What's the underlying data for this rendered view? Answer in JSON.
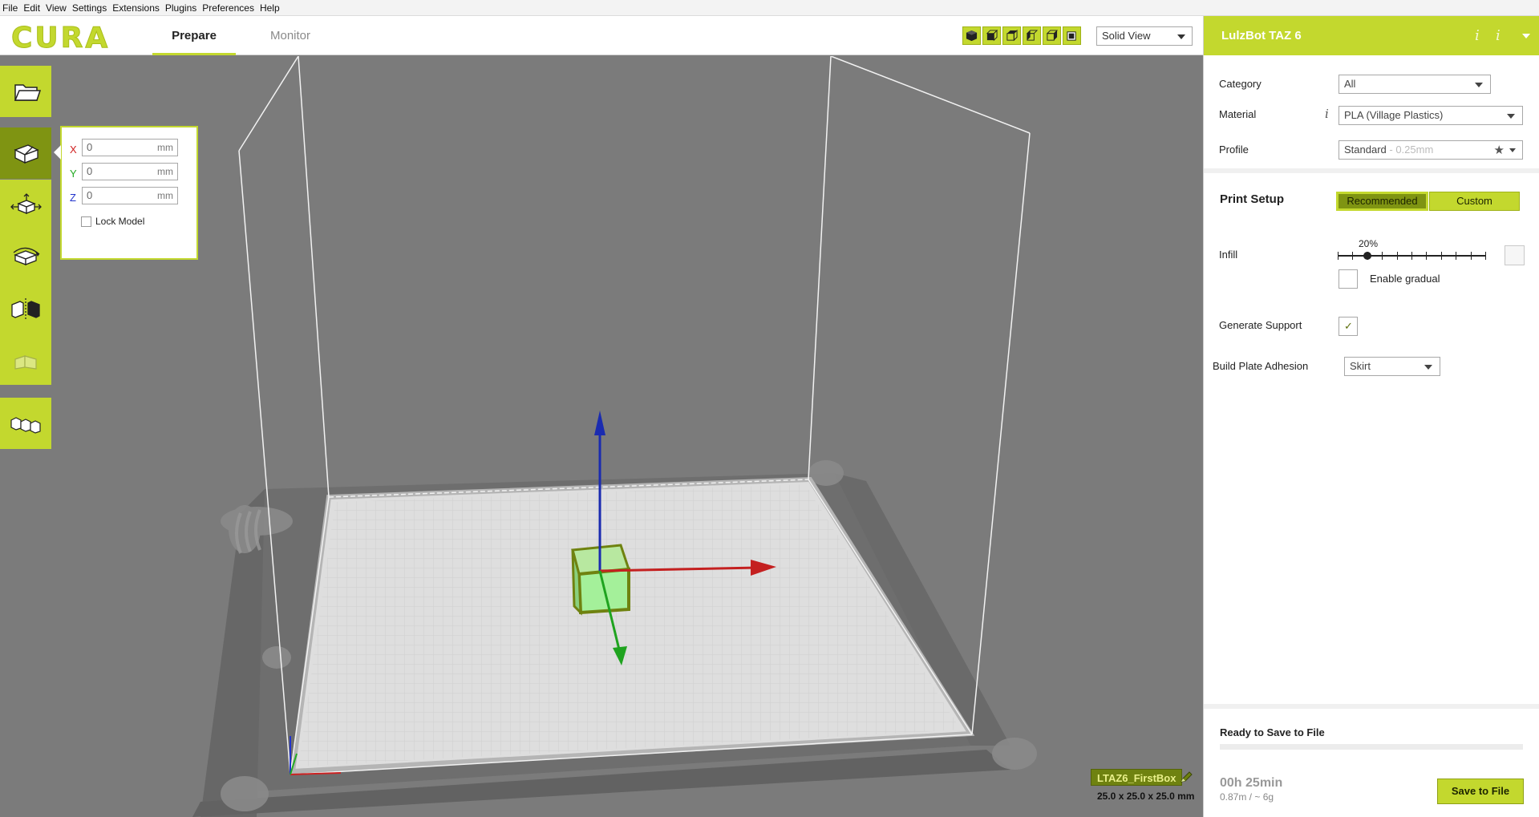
{
  "menu": [
    "File",
    "Edit",
    "View",
    "Settings",
    "Extensions",
    "Plugins",
    "Preferences",
    "Help"
  ],
  "header": {
    "logo": "CURA",
    "tabs": [
      "Prepare",
      "Monitor"
    ],
    "view_mode": "Solid View",
    "view_buttons": [
      "3d-view-icon",
      "front-view-icon",
      "top-view-icon",
      "left-view-icon",
      "right-view-icon",
      "x-ray-icon"
    ]
  },
  "panel": {
    "printer": "LulzBot TAZ 6",
    "category_label": "Category",
    "category_value": "All",
    "material_label": "Material",
    "material_value": "PLA (Village Plastics)",
    "profile_label": "Profile",
    "profile_value": "Standard",
    "profile_suffix": " - 0.25mm",
    "print_setup": "Print Setup",
    "recommended": "Recommended",
    "custom": "Custom",
    "infill_label": "Infill",
    "infill_value": "20%",
    "infill_fraction": 0.2,
    "enable_gradual": "Enable gradual",
    "generate_support": "Generate Support",
    "generate_support_checked": true,
    "adhesion_label": "Build Plate Adhesion",
    "adhesion_value": "Skirt",
    "status": "Ready to Save to File",
    "time": "00h 25min",
    "usage": "0.87m / ~ 6g",
    "save_button": "Save to File"
  },
  "tools": [
    "open-file-icon",
    "translate-icon",
    "move-icon",
    "rotate-icon",
    "mirror-icon",
    "per-model-settings-icon",
    "multiply-icon"
  ],
  "position": {
    "x_label": "X",
    "x_value": "0",
    "y_label": "Y",
    "y_value": "0",
    "z_label": "Z",
    "z_value": "0",
    "unit": "mm",
    "lock_model": "Lock Model"
  },
  "model": {
    "name": "LTAZ6_FirstBox",
    "dimensions": "25.0 x 25.0 x 25.0 mm"
  },
  "colors": {
    "accent": "#c3d82e",
    "accent_dark": "#7f9412",
    "viewport_bg": "#7b7b7b"
  }
}
